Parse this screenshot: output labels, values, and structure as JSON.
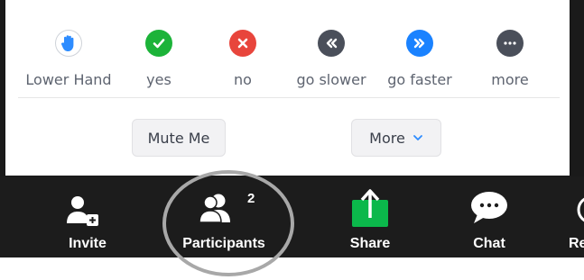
{
  "reactions": [
    {
      "label": "Lower Hand",
      "icon": "raise-hand-icon",
      "color": "#2d8cff"
    },
    {
      "label": "yes",
      "icon": "check-icon",
      "color": "#1cb339"
    },
    {
      "label": "no",
      "icon": "x-icon",
      "color": "#e8453c"
    },
    {
      "label": "go slower",
      "icon": "rewind-icon",
      "color": "#4a4f5a"
    },
    {
      "label": "go faster",
      "icon": "fast-forward-icon",
      "color": "#1a82ff"
    },
    {
      "label": "more",
      "icon": "ellipsis-icon",
      "color": "#4a4f5a"
    }
  ],
  "buttons": {
    "mute": "Mute Me",
    "more": "More"
  },
  "toolbar": {
    "invite": "Invite",
    "participants": "Participants",
    "participant_count": "2",
    "share": "Share",
    "chat": "Chat",
    "record_partial": "Re"
  },
  "colors": {
    "share_green": "#0bb84b",
    "toolbar_bg": "#1c1c1c"
  }
}
